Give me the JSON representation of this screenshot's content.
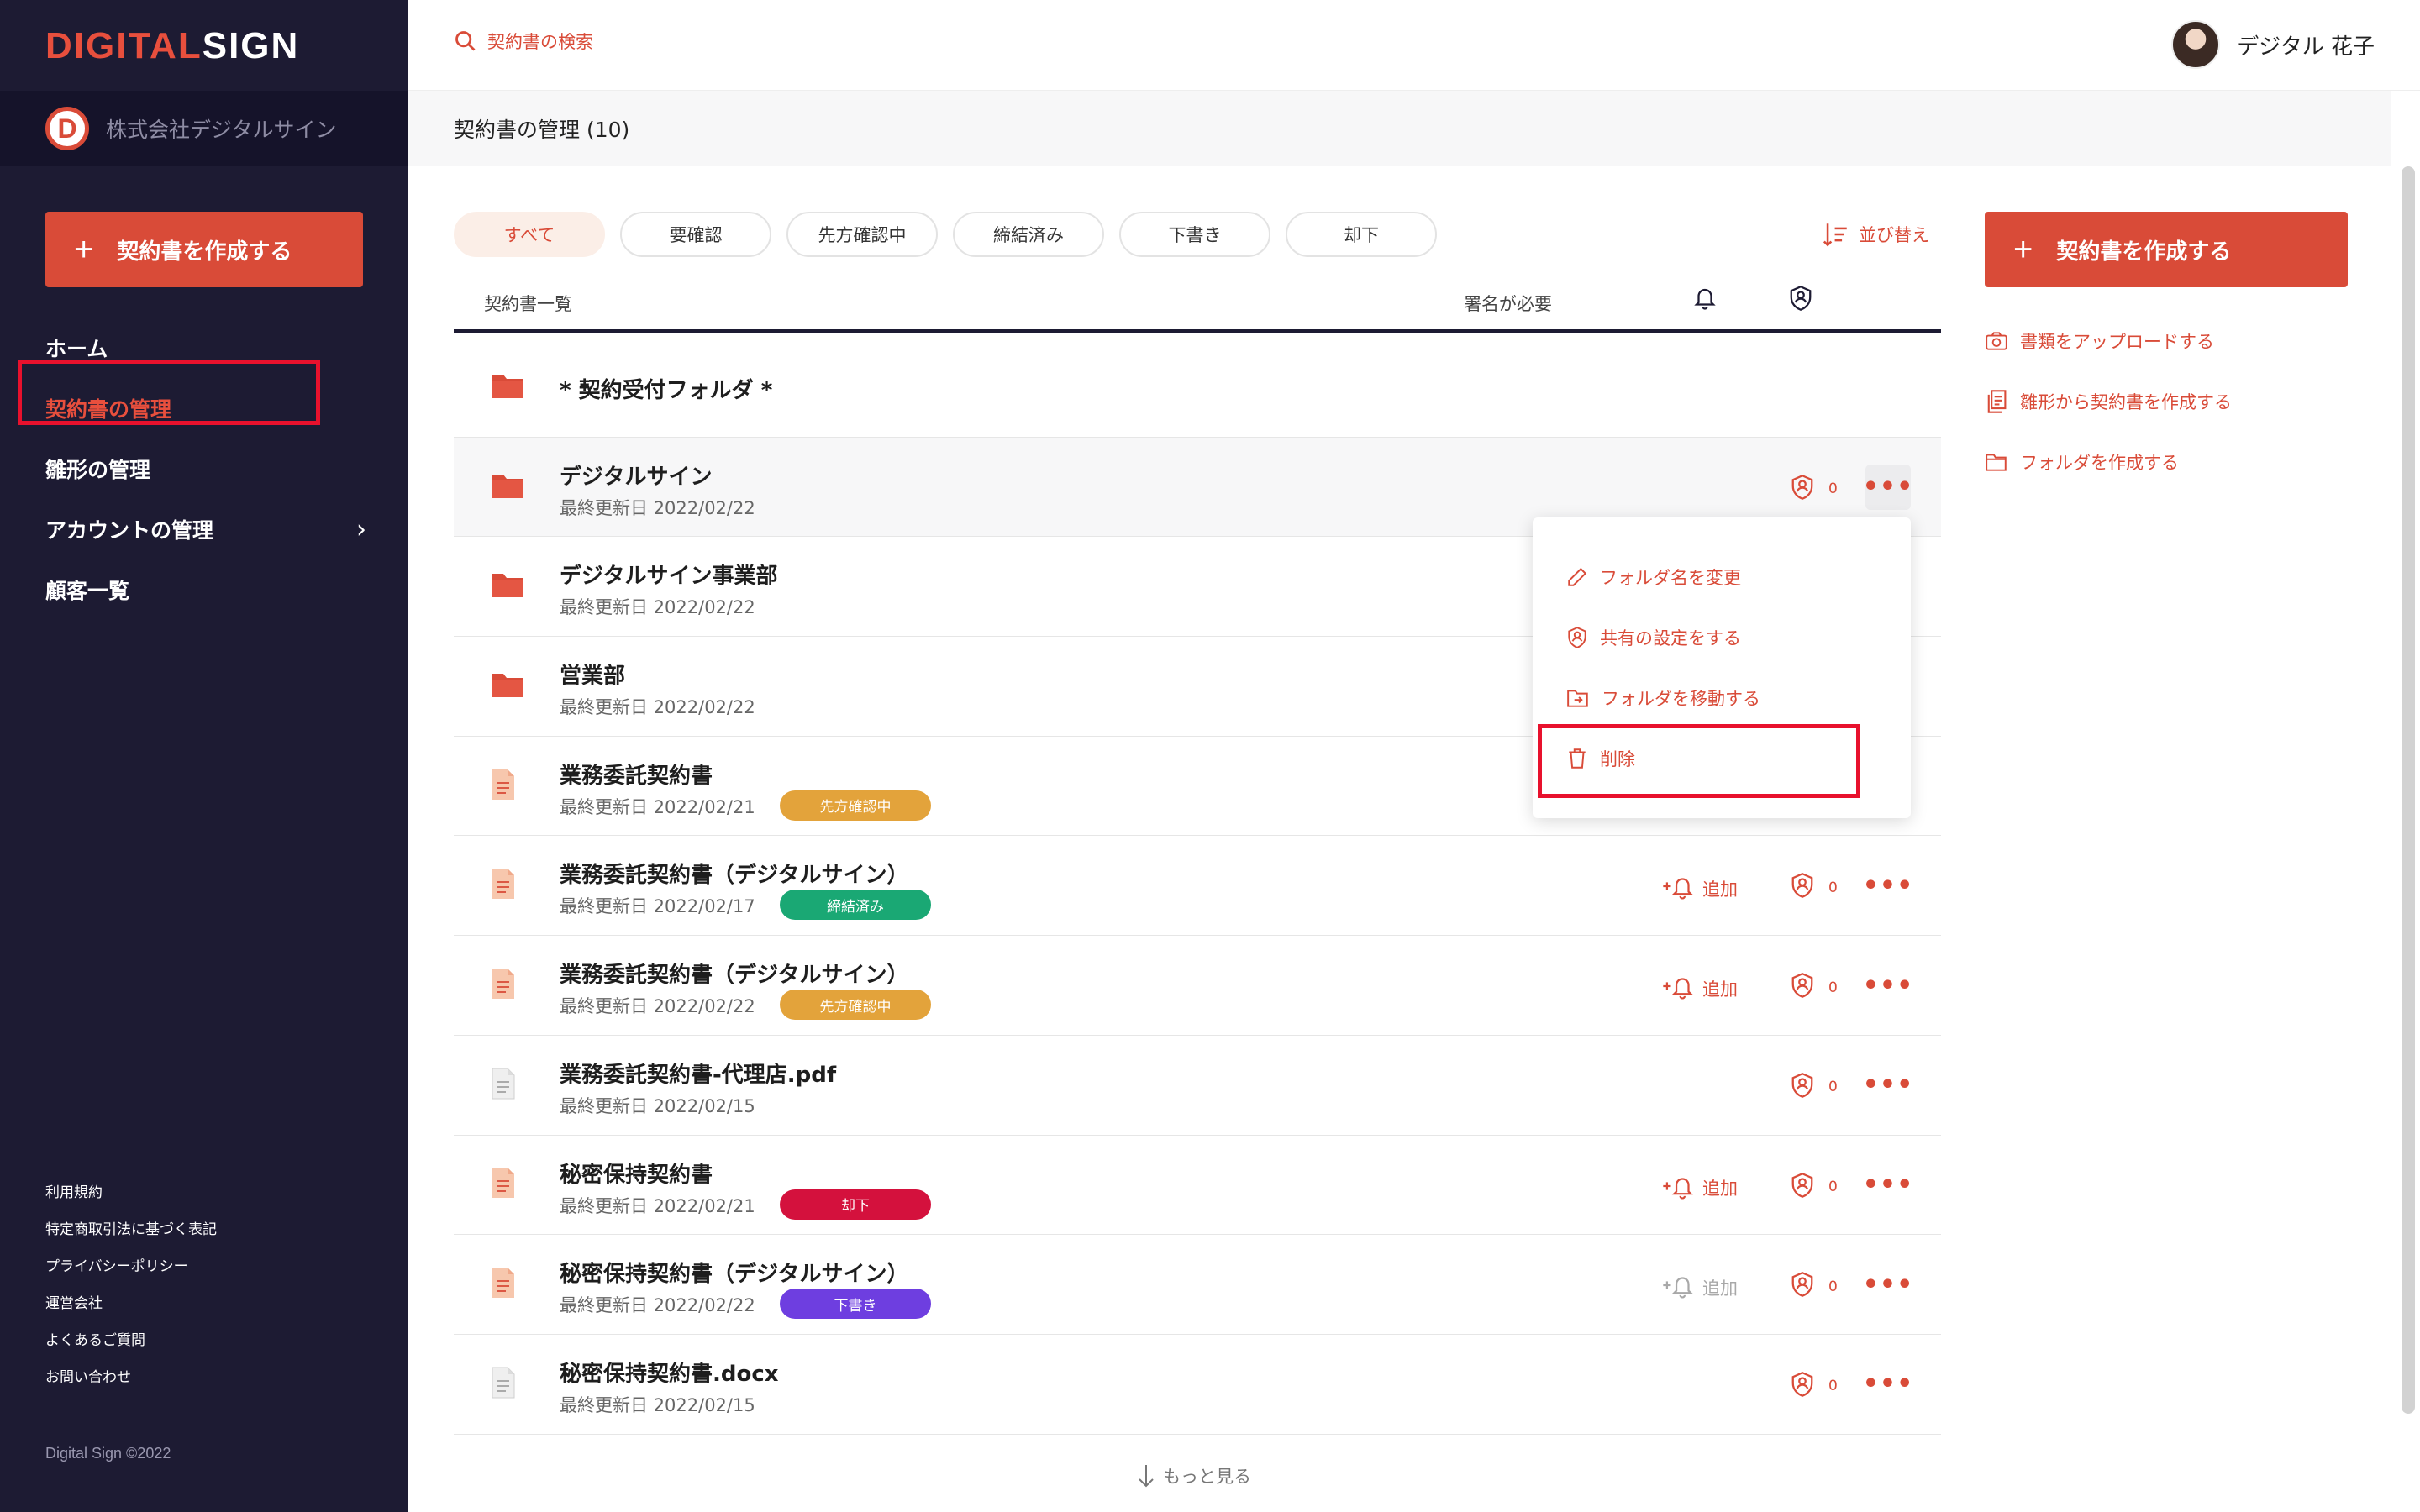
{
  "sidebar": {
    "logo_part1": "DIGITAL",
    "logo_part2": "SIGN",
    "company_badge": "D",
    "company_name": "株式会社デジタルサイン",
    "create_label": "契約書を作成する",
    "nav": [
      {
        "label": "ホーム"
      },
      {
        "label": "契約書の管理"
      },
      {
        "label": "雛形の管理"
      },
      {
        "label": "アカウントの管理"
      },
      {
        "label": "顧客一覧"
      }
    ],
    "footer_links": [
      "利用規約",
      "特定商取引法に基づく表記",
      "プライバシーポリシー",
      "運営会社",
      "よくあるご質問",
      "お問い合わせ"
    ],
    "copyright": "Digital Sign ©2022"
  },
  "topbar": {
    "search_placeholder": "契約書の検索",
    "user_name": "デジタル 花子"
  },
  "page_title": "契約書の管理 (10)",
  "filters": [
    "すべて",
    "要確認",
    "先方確認中",
    "締結済み",
    "下書き",
    "却下"
  ],
  "sort_label": "並び替え",
  "list_header": {
    "col_list": "契約書一覧",
    "col_sign": "署名が必要"
  },
  "rows": [
    {
      "title": "* 契約受付フォルダ *",
      "date": "",
      "tag": "",
      "type": "folder",
      "bell": "none",
      "shield_count": ""
    },
    {
      "title": "デジタルサイン",
      "date": "最終更新日 2022/02/22",
      "tag": "",
      "type": "folder",
      "bell": "none",
      "shield_count": "0"
    },
    {
      "title": "デジタルサイン事業部",
      "date": "最終更新日 2022/02/22",
      "tag": "",
      "type": "folder",
      "bell": "none",
      "shield_count": ""
    },
    {
      "title": "営業部",
      "date": "最終更新日 2022/02/22",
      "tag": "",
      "type": "folder",
      "bell": "none",
      "shield_count": ""
    },
    {
      "title": "業務委託契約書",
      "date": "最終更新日 2022/02/21",
      "tag": "先方確認中",
      "type": "doc",
      "bell": "none",
      "shield_count": ""
    },
    {
      "title": "業務委託契約書（デジタルサイン）",
      "date": "最終更新日 2022/02/17",
      "tag": "締結済み",
      "type": "doc",
      "bell": "active",
      "shield_count": "0"
    },
    {
      "title": "業務委託契約書（デジタルサイン）",
      "date": "最終更新日 2022/02/22",
      "tag": "先方確認中",
      "type": "doc",
      "bell": "active",
      "shield_count": "0"
    },
    {
      "title": "業務委託契約書-代理店.pdf",
      "date": "最終更新日 2022/02/15",
      "tag": "",
      "type": "file",
      "bell": "none",
      "shield_count": "0"
    },
    {
      "title": "秘密保持契約書",
      "date": "最終更新日 2022/02/21",
      "tag": "却下",
      "type": "doc",
      "bell": "active",
      "shield_count": "0"
    },
    {
      "title": "秘密保持契約書（デジタルサイン）",
      "date": "最終更新日 2022/02/22",
      "tag": "下書き",
      "type": "doc",
      "bell": "disabled",
      "shield_count": "0"
    },
    {
      "title": "秘密保持契約書.docx",
      "date": "最終更新日 2022/02/15",
      "tag": "",
      "type": "file",
      "bell": "none",
      "shield_count": "0"
    }
  ],
  "bell_add_label": "追加",
  "tag_colors": {
    "先方確認中": "#e3a33b",
    "締結済み": "#1aa874",
    "却下": "#d4113d",
    "下書き": "#6e3ee0"
  },
  "dropdown": {
    "rename": "フォルダ名を変更",
    "share": "共有の設定をする",
    "move": "フォルダを移動する",
    "delete": "削除"
  },
  "load_more": "もっと見る",
  "right_panel": {
    "create_label": "契約書を作成する",
    "links": [
      "書類をアップロードする",
      "雛形から契約書を作成する",
      "フォルダを作成する"
    ]
  },
  "colors": {
    "accent": "#d94b38",
    "sidebar_bg": "#1d1b33",
    "highlight": "#e8112d"
  }
}
